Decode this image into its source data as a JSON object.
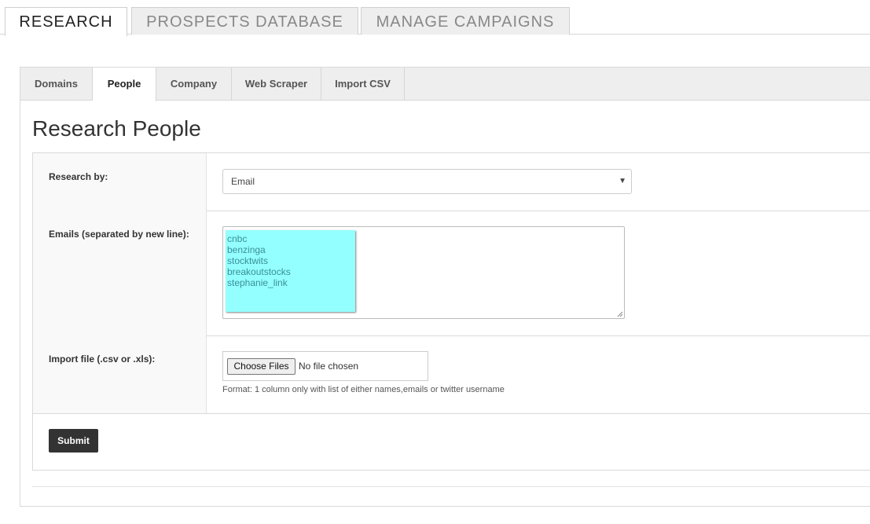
{
  "top_tabs": [
    {
      "label": "RESEARCH",
      "active": true
    },
    {
      "label": "PROSPECTS DATABASE",
      "active": false
    },
    {
      "label": "MANAGE CAMPAIGNS",
      "active": false
    }
  ],
  "sub_tabs": [
    {
      "label": "Domains",
      "active": false
    },
    {
      "label": "People",
      "active": true
    },
    {
      "label": "Company",
      "active": false
    },
    {
      "label": "Web Scraper",
      "active": false
    },
    {
      "label": "Import CSV",
      "active": false
    }
  ],
  "page": {
    "title": "Research People"
  },
  "form": {
    "research_by": {
      "label": "Research by:",
      "selected": "Email"
    },
    "emails": {
      "label": "Emails (separated by new line):",
      "lines": [
        "cnbc",
        "benzinga",
        "stocktwits",
        "breakoutstocks",
        "stephanie_link"
      ]
    },
    "import_file": {
      "label": "Import file (.csv or .xls):",
      "button_label": "Choose Files",
      "status": "No file chosen",
      "note": "Format: 1 column only with list of either names,emails or twitter username"
    },
    "submit_label": "Submit"
  },
  "colors": {
    "sticky_note": "#93fffe",
    "submit": "#333333"
  }
}
